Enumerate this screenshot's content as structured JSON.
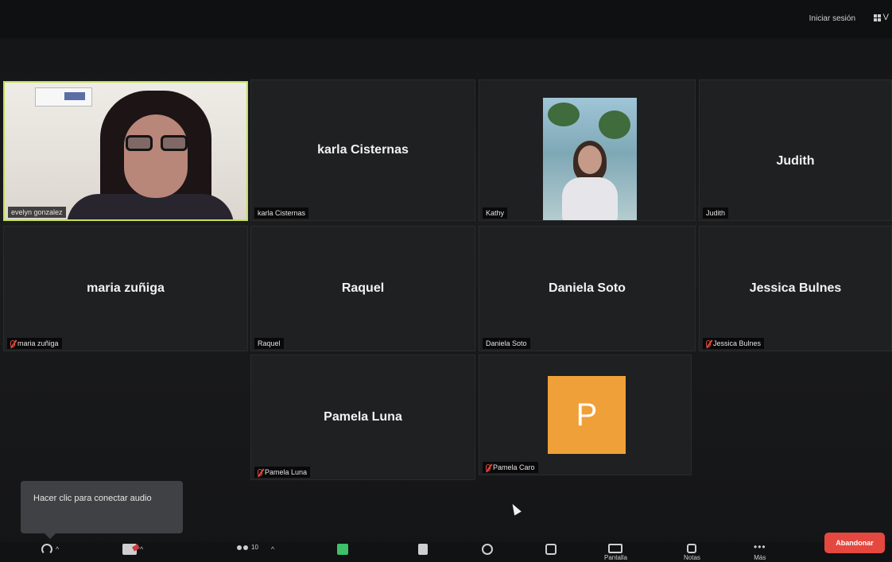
{
  "topbar": {
    "signin_label": "Iniciar sesión",
    "view_label": "V"
  },
  "tiles": [
    {
      "id": "evelyn",
      "label": "evelyn gonzalez",
      "type": "video"
    },
    {
      "id": "karla",
      "center": "karla Cisternas",
      "label": "karla Cisternas"
    },
    {
      "id": "kathy",
      "label": "Kathy",
      "type": "video"
    },
    {
      "id": "judith",
      "center": "Judith",
      "label": "Judith"
    },
    {
      "id": "maria",
      "center": "maria zuñiga",
      "label": "maria zuñiga",
      "muted": true
    },
    {
      "id": "raquel",
      "center": "Raquel",
      "label": "Raquel"
    },
    {
      "id": "daniela",
      "center": "Daniela Soto",
      "label": "Daniela Soto"
    },
    {
      "id": "jessica",
      "center": "Jessica Bulnes",
      "label": "Jessica Bulnes",
      "muted": true
    },
    {
      "id": "pamela_luna",
      "center": "Pamela Luna",
      "label": "Pamela Luna",
      "muted": true
    },
    {
      "id": "pamela_caro",
      "avatar_letter": "P",
      "label": "Pamela Caro",
      "muted": true,
      "avatar_color": "#f0a038"
    }
  ],
  "tooltip": {
    "text": "Hacer clic para conectar audio"
  },
  "toolbar": {
    "participants_count": "10",
    "more_label": "Más",
    "screen_label": "Pantalla",
    "notes_label": "Notas",
    "end_label": "Abandonar"
  },
  "colors": {
    "end_button": "#e5483f",
    "active_speaker": "#c5e05a",
    "muted_mic": "#e04a3a"
  }
}
